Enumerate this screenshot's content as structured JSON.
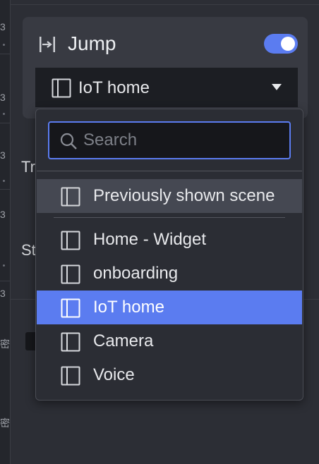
{
  "jump": {
    "title": "Jump",
    "icon": "jump-icon",
    "enabled": true,
    "selected_scene": "IoT home"
  },
  "background": {
    "label_tr": "Tr",
    "label_st": "St",
    "left_glyph_1": "密",
    "left_glyph_2": "密"
  },
  "dropdown": {
    "search_placeholder": "Search",
    "previous_item": "Previously shown scene",
    "items": [
      {
        "label": "Home - Widget"
      },
      {
        "label": "onboarding"
      },
      {
        "label": "IoT home",
        "selected": true
      },
      {
        "label": "Camera"
      },
      {
        "label": "Voice"
      }
    ]
  },
  "colors": {
    "accent": "#5b7cf0",
    "panel": "#383a42",
    "background": "#2c2e35",
    "dropdown": "#2b2d34"
  }
}
